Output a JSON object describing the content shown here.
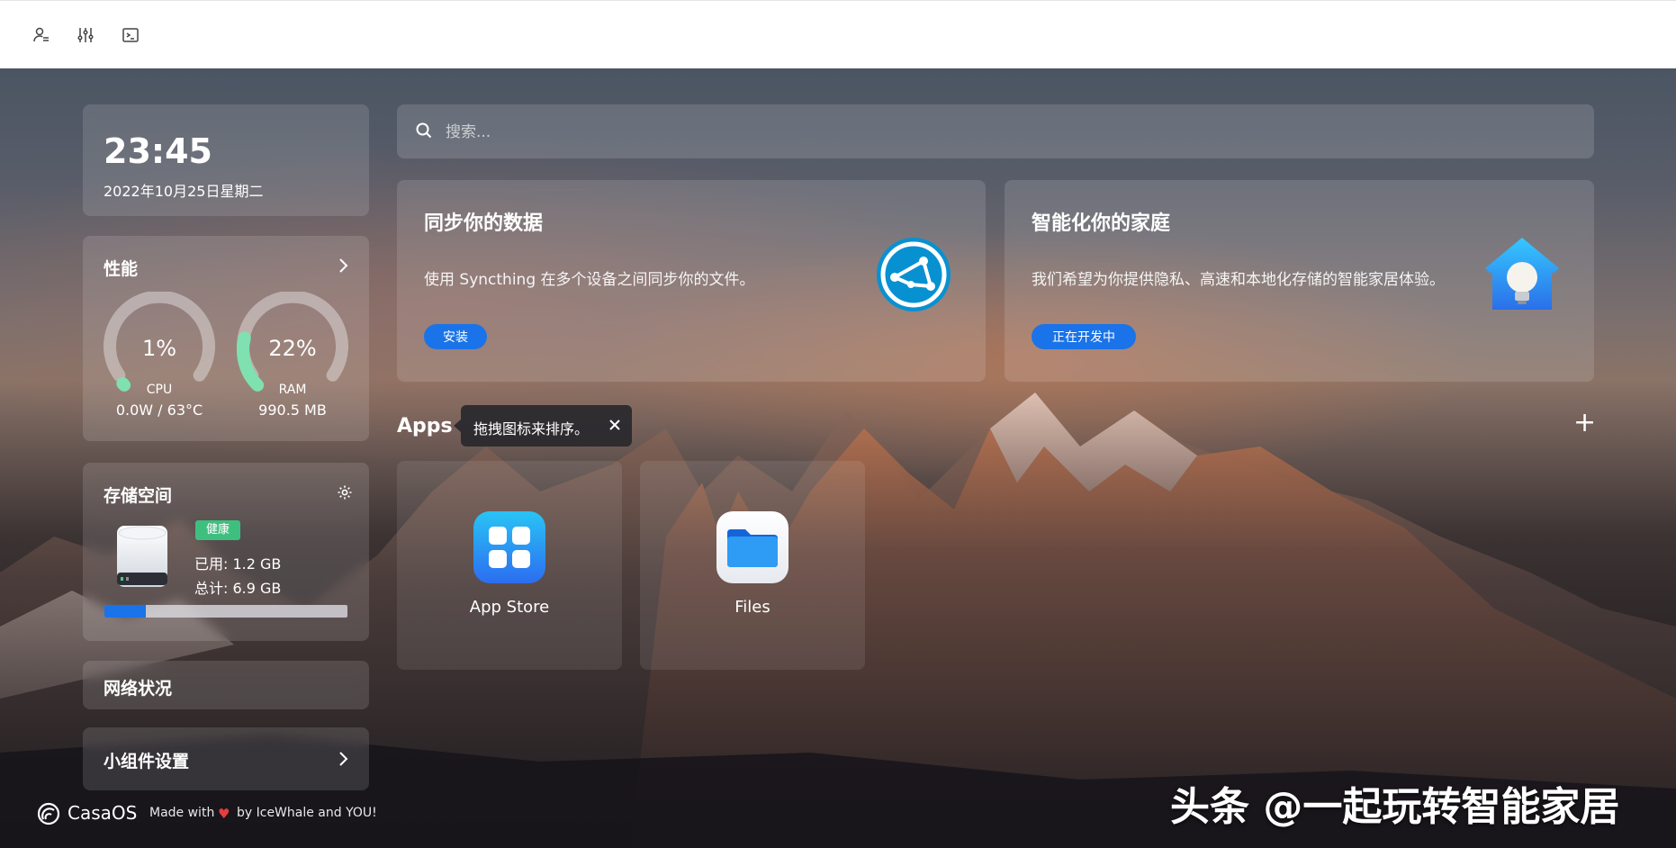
{
  "topbar": {
    "icons": [
      "user-settings-icon",
      "sliders-icon",
      "terminal-icon"
    ]
  },
  "clock": {
    "time": "23:45",
    "date": "2022年10月25日星期二"
  },
  "performance": {
    "title": "性能",
    "cpu": {
      "percent_label": "1%",
      "percent": 1,
      "name": "CPU",
      "detail": "0.0W / 63°C"
    },
    "ram": {
      "percent_label": "22%",
      "percent": 22,
      "name": "RAM",
      "detail": "990.5 MB"
    }
  },
  "storage": {
    "title": "存储空间",
    "status_badge": "健康",
    "used": "已用: 1.2 GB",
    "total": "总计: 6.9 GB",
    "used_fraction": 0.17
  },
  "network": {
    "title": "网络状况"
  },
  "widgets": {
    "title": "小组件设置"
  },
  "search": {
    "placeholder": "搜索..."
  },
  "cards": [
    {
      "title": "同步你的数据",
      "description": "使用 Syncthing 在多个设备之间同步你的文件。",
      "button": "安装"
    },
    {
      "title": "智能化你的家庭",
      "description": "我们希望为你提供隐私、高速和本地化存储的智能家居体验。",
      "button": "正在开发中"
    }
  ],
  "apps": {
    "title": "Apps",
    "tooltip": "拖拽图标来排序。",
    "add": "+",
    "items": [
      {
        "label": "App Store"
      },
      {
        "label": "Files"
      }
    ]
  },
  "footer": {
    "brand": "CasaOS",
    "made_with": "Made with",
    "by": "by IceWhale and YOU!"
  },
  "watermark": "头条 @一起玩转智能家居",
  "colors": {
    "accent": "#1a73e8",
    "gauge_fill": "#7fe0b0",
    "badge": "#3fbf7f"
  }
}
